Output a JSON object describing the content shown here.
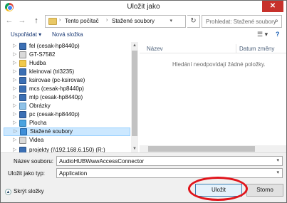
{
  "window": {
    "title": "Uložit jako",
    "close_glyph": "✕"
  },
  "nav": {
    "back_glyph": "←",
    "forward_glyph": "→",
    "up_glyph": "↑",
    "breadcrumb": [
      "Tento počítač",
      "Stažené soubory"
    ],
    "crumb_sep": "›",
    "refresh_glyph": "↻",
    "search_placeholder": "Prohledat: Stažené soubory",
    "search_glyph": "⌕",
    "dropdown_glyph": "▾"
  },
  "toolbar": {
    "organize_label": "Uspořádat ▾",
    "new_folder_label": "Nová složka",
    "view_glyph": "☰ ▾",
    "help_glyph": "?"
  },
  "tree": {
    "items": [
      {
        "label": "fel (cesak-hp8440p)",
        "icon": "network-drive-icon"
      },
      {
        "label": "GT-S7582",
        "icon": "phone-icon"
      },
      {
        "label": "Hudba",
        "icon": "music-folder-icon"
      },
      {
        "label": "kleinovai (tri3235)",
        "icon": "network-drive-icon"
      },
      {
        "label": "ksirovae (pc-ksirovae)",
        "icon": "network-drive-icon"
      },
      {
        "label": "mcs (cesak-hp8440p)",
        "icon": "network-drive-icon"
      },
      {
        "label": "mlp (cesak-hp8440p)",
        "icon": "network-drive-icon"
      },
      {
        "label": "Obrázky",
        "icon": "pictures-folder-icon"
      },
      {
        "label": "pc (cesak-hp8440p)",
        "icon": "network-drive-icon"
      },
      {
        "label": "Plocha",
        "icon": "desktop-folder-icon"
      },
      {
        "label": "Stažené soubory",
        "icon": "downloads-folder-icon"
      },
      {
        "label": "Videa",
        "icon": "videos-folder-icon"
      },
      {
        "label": "projekty (\\\\192.168.6.150) (R:)",
        "icon": "network-drive-icon"
      }
    ],
    "selected_label": "Stažené soubory",
    "expand_glyph": "▷"
  },
  "content": {
    "col_name": "Název",
    "col_date": "Datum změny",
    "empty_text": "Hledání neodpovídají žádné položky."
  },
  "form": {
    "filename_label": "Název souboru:",
    "filename_value": "AudioHUBWwwAccessConnector",
    "filetype_label": "Uložit jako typ:",
    "filetype_value": "Application"
  },
  "footer": {
    "hide_folders_label": "Skrýt složky",
    "hide_folders_glyph": "▲",
    "save_label": "Uložit",
    "cancel_label": "Storno"
  },
  "colors": {
    "selection": "#cce8ff",
    "close": "#c7312b",
    "annotation_ring": "#e0141b"
  }
}
